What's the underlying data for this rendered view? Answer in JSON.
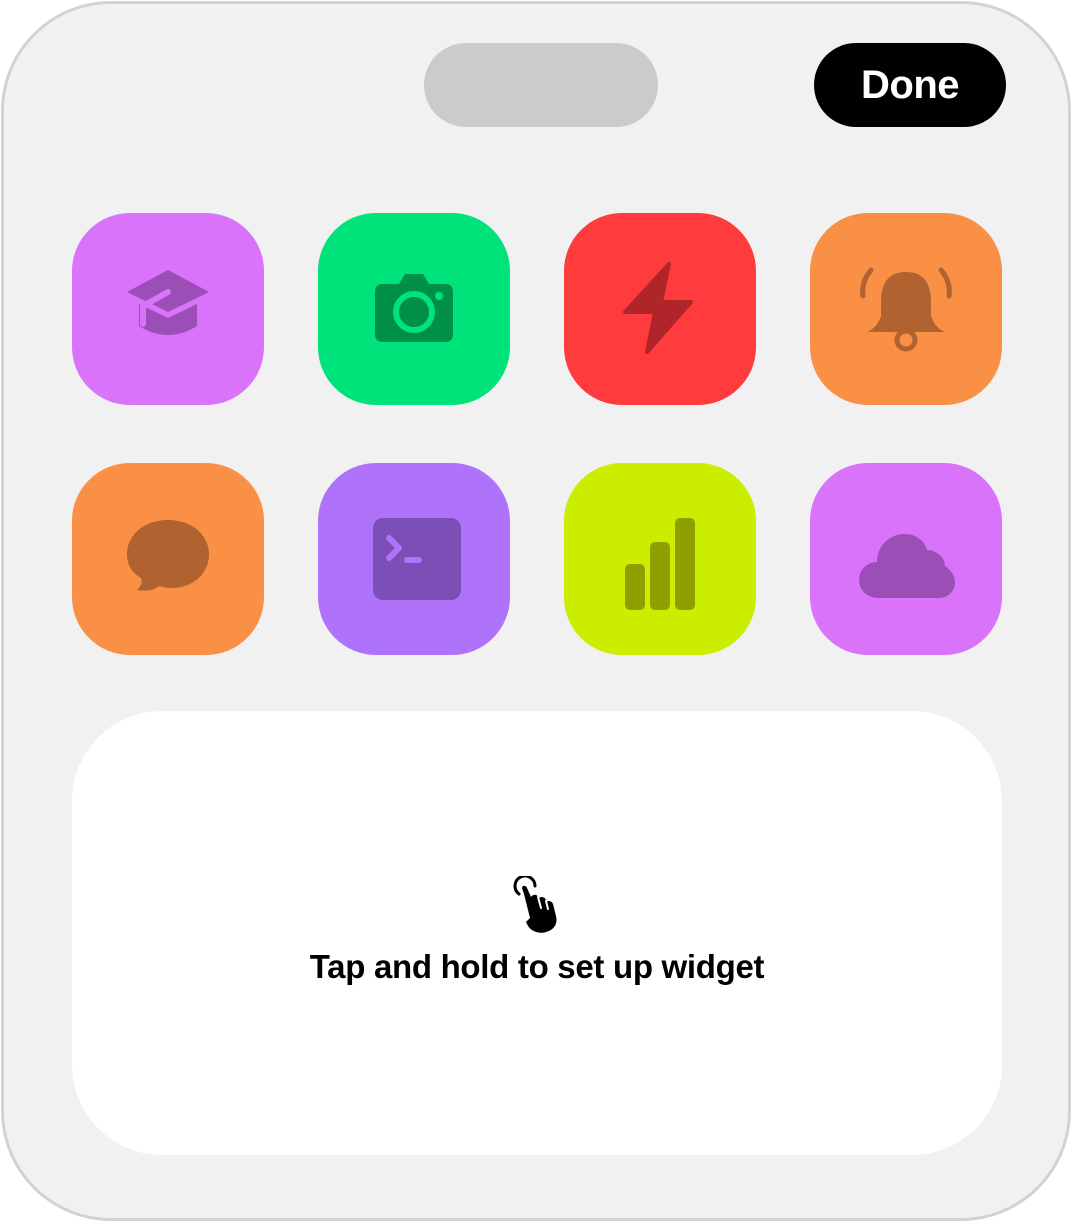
{
  "header": {
    "done_label": "Done"
  },
  "apps": [
    {
      "name": "education",
      "icon": "graduation-cap-icon",
      "bg": "#d873fa",
      "fg": "#9b4fb6"
    },
    {
      "name": "camera",
      "icon": "camera-icon",
      "bg": "#00e27a",
      "fg": "#008f47"
    },
    {
      "name": "energy",
      "icon": "lightning-bolt-icon",
      "bg": "#ff3b3e",
      "fg": "#b0252a"
    },
    {
      "name": "alarm",
      "icon": "ringing-bell-icon",
      "bg": "#fa9046",
      "fg": "#b06230"
    },
    {
      "name": "messages",
      "icon": "speech-bubble-icon",
      "bg": "#fa9046",
      "fg": "#b06230"
    },
    {
      "name": "terminal",
      "icon": "terminal-icon",
      "bg": "#ae73fa",
      "fg": "#7b4fb6"
    },
    {
      "name": "signal",
      "icon": "signal-bars-icon",
      "bg": "#cbee00",
      "fg": "#8f9f00"
    },
    {
      "name": "weather",
      "icon": "cloud-icon",
      "bg": "#d873fa",
      "fg": "#9b4fb6"
    }
  ],
  "widget": {
    "label": "Tap and hold to set up widget",
    "icon": "tap-hand-icon"
  }
}
